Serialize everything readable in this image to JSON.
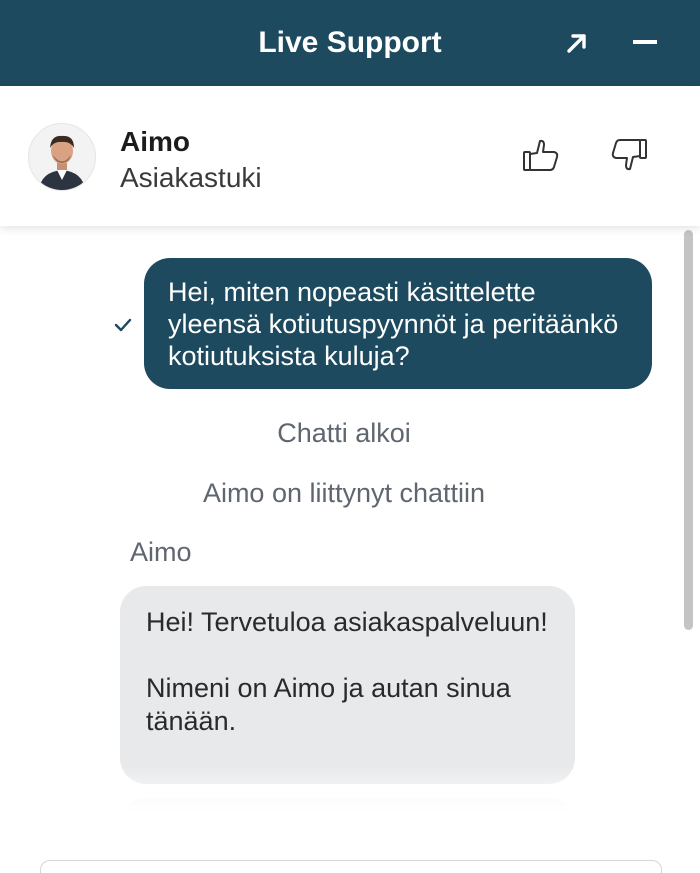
{
  "window": {
    "title": "Live Support",
    "expand_icon": "arrow-up-right-icon",
    "minimize_icon": "minus-icon"
  },
  "agent": {
    "name": "Aimo",
    "role": "Asiakastuki",
    "avatar_icon": "agent-avatar"
  },
  "rating": {
    "thumbs_up_icon": "thumbs-up-icon",
    "thumbs_down_icon": "thumbs-down-icon"
  },
  "chat": {
    "user_message": "Hei, miten nopeasti käsittelette yleensä kotiutuspyynnöt ja peritäänkö kotiutuksista kuluja?",
    "user_message_status_icon": "check-icon",
    "system_chat_started": "Chatti alkoi",
    "system_agent_joined": "Aimo on liittynyt chattiin",
    "agent_sender_name": "Aimo",
    "agent_message_para1": "Hei! Tervetuloa asiakaspalveluun!",
    "agent_message_para2": "Nimeni on Aimo ja autan sinua tänään."
  },
  "colors": {
    "brand": "#1d4a5e",
    "agent_bubble": "#e8e9eb",
    "system_text": "#5f6670"
  }
}
